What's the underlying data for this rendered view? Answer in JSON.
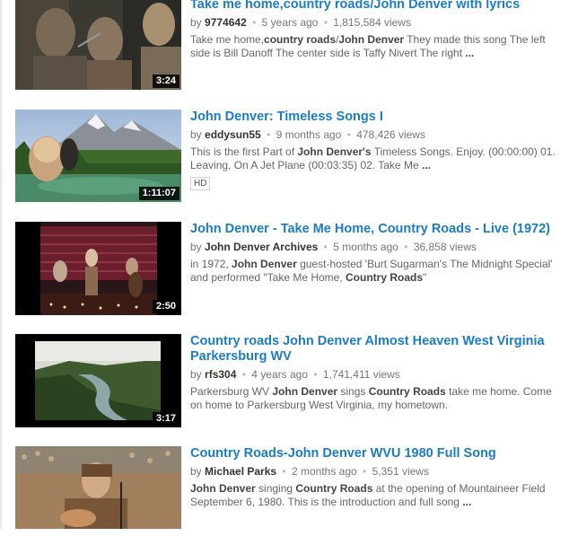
{
  "results": [
    {
      "title": "Take me home,country roads/John Denver with lyrics",
      "by_label": "by",
      "author": "9774642",
      "age": "5 years ago",
      "views": "1,815,584 views",
      "duration": "3:24",
      "thumbnail_icon": "video-thumbnail",
      "desc_runs": [
        {
          "t": "Take me home,",
          "b": false
        },
        {
          "t": "country roads",
          "b": true
        },
        {
          "t": "/",
          "b": false
        },
        {
          "t": "John Denver",
          "b": true
        },
        {
          "t": " They made this song The left side is Bill Danoff The center side is Taffy Nivert The right ",
          "b": false
        },
        {
          "t": "...",
          "b": true
        }
      ]
    },
    {
      "title": "John Denver: Timeless Songs I",
      "by_label": "by",
      "author": "eddysun55",
      "age": "9 months ago",
      "views": "478,426 views",
      "duration": "1:11:07",
      "badge": "HD",
      "thumbnail_icon": "video-thumbnail",
      "desc_runs": [
        {
          "t": "This is the first Part of ",
          "b": false
        },
        {
          "t": "John Denver's",
          "b": true
        },
        {
          "t": " Timeless Songs. Enjoy. (00:00:00) 01. Leaving, On A Jet Plane (00:03:35) 02. Take Me ",
          "b": false
        },
        {
          "t": "...",
          "b": true
        }
      ]
    },
    {
      "title": "John Denver - Take Me Home, Country Roads - Live (1972)",
      "by_label": "by",
      "author": "John Denver Archives",
      "age": "5 months ago",
      "views": "36,858 views",
      "duration": "2:50",
      "thumbnail_icon": "video-thumbnail",
      "desc_runs": [
        {
          "t": "in 1972, ",
          "b": false
        },
        {
          "t": "John Denver",
          "b": true
        },
        {
          "t": " guest-hosted 'Burt Sugarman's The Midnight Special' and performed \"Take Me Home, ",
          "b": false
        },
        {
          "t": "Country Roads",
          "b": true
        },
        {
          "t": "\"",
          "b": false
        }
      ]
    },
    {
      "title": "Country roads John Denver Almost Heaven West Virginia Parkersburg WV",
      "by_label": "by",
      "author": "rfs304",
      "age": "4 years ago",
      "views": "1,741,411 views",
      "duration": "3:17",
      "thumbnail_icon": "video-thumbnail",
      "desc_runs": [
        {
          "t": "Parkersburg WV ",
          "b": false
        },
        {
          "t": "John Denver",
          "b": true
        },
        {
          "t": " sings ",
          "b": false
        },
        {
          "t": "Country Roads",
          "b": true
        },
        {
          "t": " take me home. Come on home to Parkersburg West Virginia, my hometown.",
          "b": false
        }
      ]
    },
    {
      "title": "Country Roads-John Denver WVU 1980 Full Song",
      "by_label": "by",
      "author": "Michael Parks",
      "age": "2 months ago",
      "views": "5,351 views",
      "thumbnail_icon": "video-thumbnail",
      "desc_runs": [
        {
          "t": "John Denver",
          "b": true
        },
        {
          "t": " singing ",
          "b": false
        },
        {
          "t": "Country Roads",
          "b": true
        },
        {
          "t": " at the opening of Mountaineer Field September 6, 1980. This is the introduction and full song ",
          "b": false
        },
        {
          "t": "...",
          "b": true
        }
      ]
    }
  ]
}
